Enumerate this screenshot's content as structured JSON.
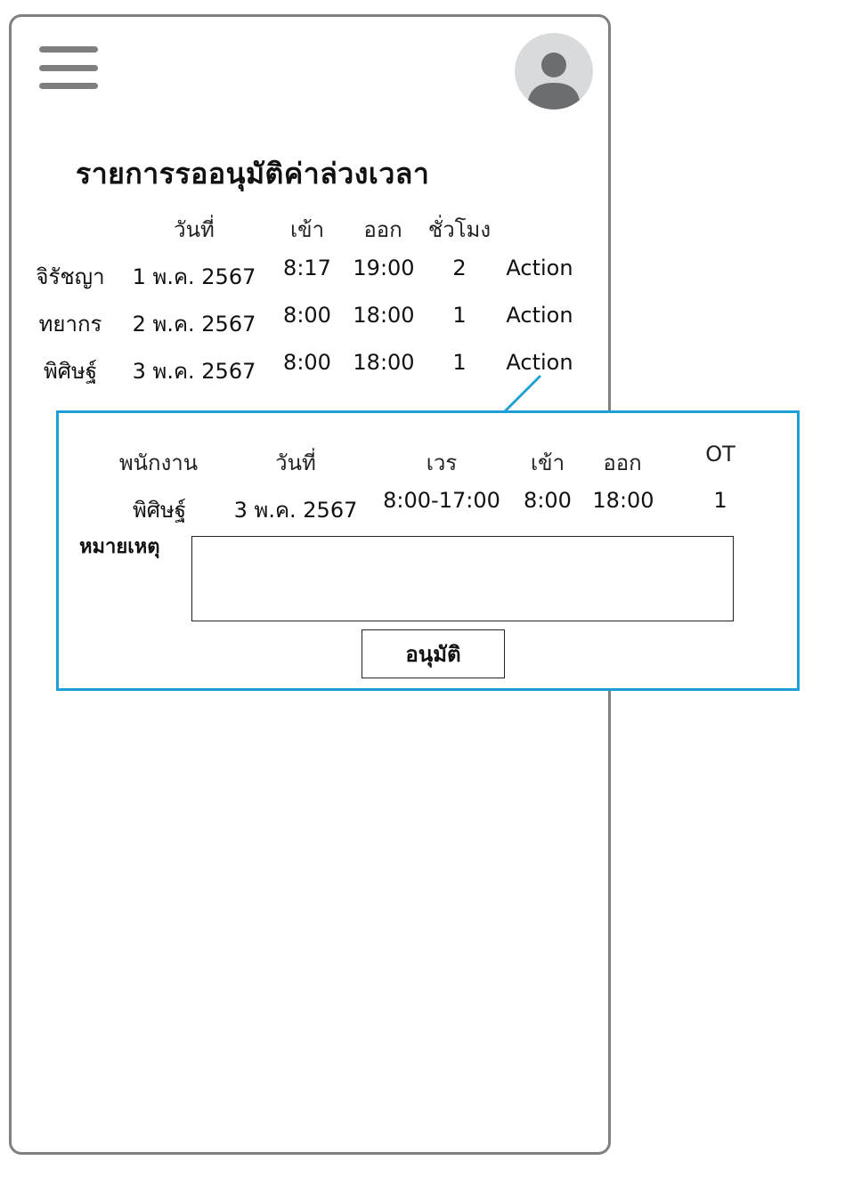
{
  "header": {
    "menu_icon": "hamburger-menu-icon",
    "avatar_icon": "user-avatar-icon"
  },
  "page": {
    "title": "รายการรออนุมัติค่าล่วงเวลา"
  },
  "table": {
    "headers": {
      "date": "วันที่",
      "in": "เข้า",
      "out": "ออก",
      "hours": "ชั่วโมง"
    },
    "rows": [
      {
        "name": "จิรัชญา",
        "date": "1 พ.ค. 2567",
        "in": "8:17",
        "out": "19:00",
        "hours": "2",
        "action": "Action"
      },
      {
        "name": "ทยากร",
        "date": "2 พ.ค. 2567",
        "in": "8:00",
        "out": "18:00",
        "hours": "1",
        "action": "Action"
      },
      {
        "name": "พิศิษฐ์",
        "date": "3 พ.ค. 2567",
        "in": "8:00",
        "out": "18:00",
        "hours": "1",
        "action": "Action"
      }
    ]
  },
  "modal": {
    "headers": {
      "employee": "พนักงาน",
      "date": "วันที่",
      "shift": "เวร",
      "in": "เข้า",
      "out": "ออก",
      "ot": "OT"
    },
    "row": {
      "employee": "พิศิษฐ์",
      "date": "3 พ.ค. 2567",
      "shift": "8:00-17:00",
      "in": "8:00",
      "out": "18:00",
      "ot": "1"
    },
    "remark_label": "หมายเหตุ",
    "remark_value": "",
    "approve_label": "อนุมัติ"
  },
  "colors": {
    "frame": "#808080",
    "accent": "#1ea0d7",
    "avatar_bg": "#d9dadc",
    "avatar_fg": "#6b6d70"
  }
}
